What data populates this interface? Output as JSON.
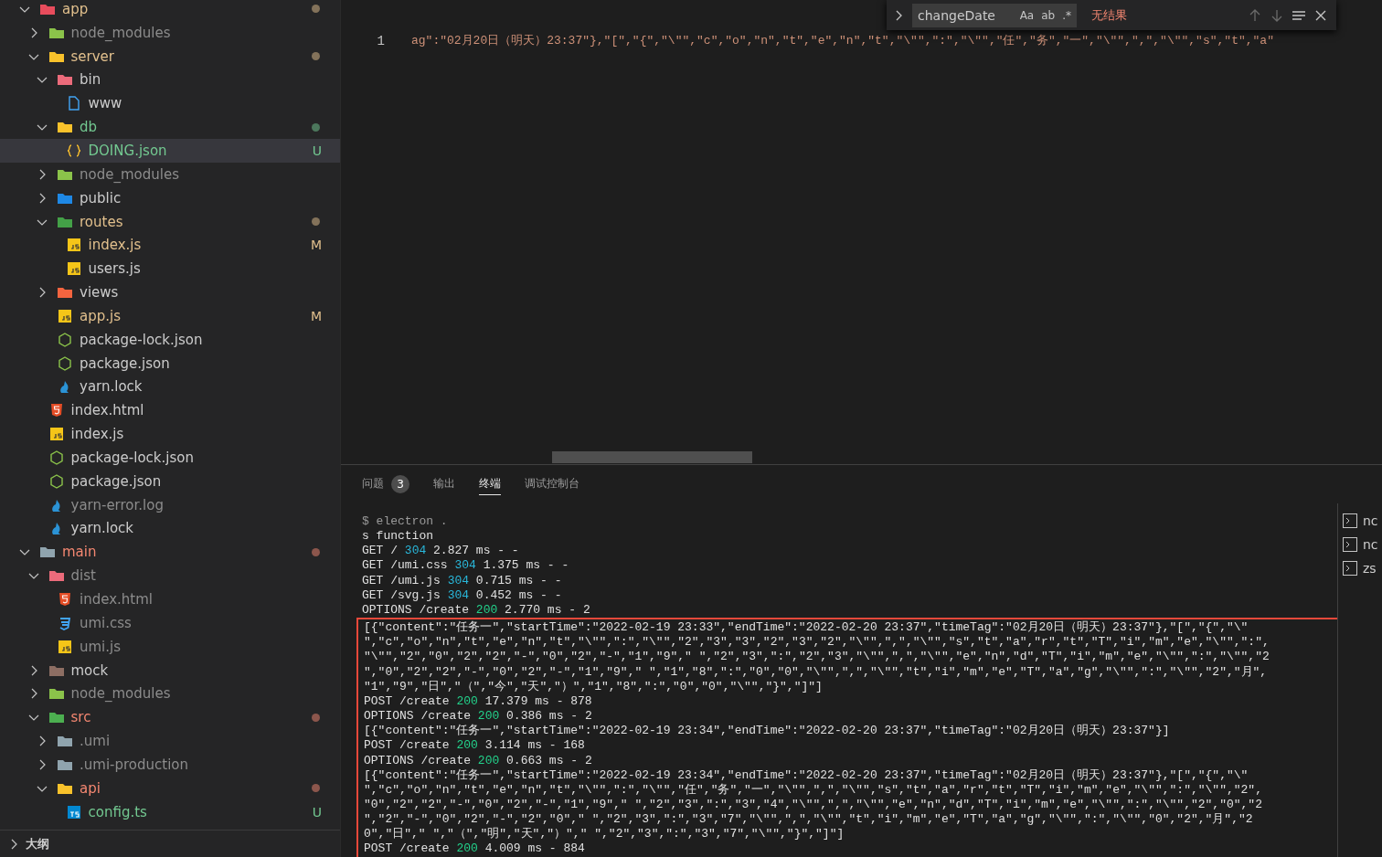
{
  "explorer": {
    "items": [
      {
        "name": "app",
        "kind": "appfolder",
        "color": "#e2c08d",
        "dot": true,
        "expanded": true,
        "selected": false,
        "children": [
          {
            "name": "node_modules",
            "kind": "nodefolder",
            "color": "#8c8c8c",
            "dot": false,
            "expanded": false,
            "selected": false
          },
          {
            "name": "server",
            "kind": "serverfolder",
            "color": "#e2c08d",
            "dot": true,
            "expanded": true,
            "selected": false,
            "children": [
              {
                "name": "bin",
                "kind": "binfolder",
                "color": "#cccccc",
                "dot": false,
                "expanded": true,
                "selected": false,
                "children": [
                  {
                    "name": "www",
                    "kind": "file",
                    "color": "#cccccc",
                    "dot": false,
                    "selected": false
                  }
                ]
              },
              {
                "name": "db",
                "kind": "dbfolder",
                "color": "#73c991",
                "dot": true,
                "expanded": true,
                "selected": false,
                "children": [
                  {
                    "name": "DOING.json",
                    "kind": "jsonfile",
                    "color": "#73c991",
                    "dot": false,
                    "badge": "U",
                    "selected": true
                  }
                ]
              },
              {
                "name": "node_modules",
                "kind": "nodefolder",
                "color": "#8c8c8c",
                "dot": false,
                "expanded": false,
                "selected": false
              },
              {
                "name": "public",
                "kind": "publicfolder",
                "color": "#cccccc",
                "dot": false,
                "expanded": false,
                "selected": false
              },
              {
                "name": "routes",
                "kind": "routesfolder",
                "color": "#e2c08d",
                "dot": true,
                "expanded": true,
                "selected": false,
                "children": [
                  {
                    "name": "index.js",
                    "kind": "jsfile",
                    "color": "#e2c08d",
                    "dot": false,
                    "badge": "M",
                    "selected": false
                  },
                  {
                    "name": "users.js",
                    "kind": "jsfile",
                    "color": "#cccccc",
                    "dot": false,
                    "selected": false
                  }
                ]
              },
              {
                "name": "views",
                "kind": "viewsfolder",
                "color": "#cccccc",
                "dot": false,
                "expanded": false,
                "selected": false
              },
              {
                "name": "app.js",
                "kind": "jsfile",
                "color": "#e2c08d",
                "dot": false,
                "badge": "M",
                "selected": false
              },
              {
                "name": "package-lock.json",
                "kind": "nodefile",
                "color": "#cccccc",
                "dot": false,
                "selected": false
              },
              {
                "name": "package.json",
                "kind": "nodefile",
                "color": "#cccccc",
                "dot": false,
                "selected": false
              },
              {
                "name": "yarn.lock",
                "kind": "yarnfile",
                "color": "#cccccc",
                "dot": false,
                "selected": false
              }
            ]
          },
          {
            "name": "index.html",
            "kind": "htmlfile",
            "color": "#cccccc",
            "dot": false,
            "selected": false
          },
          {
            "name": "index.js",
            "kind": "jsfile",
            "color": "#cccccc",
            "dot": false,
            "selected": false
          },
          {
            "name": "package-lock.json",
            "kind": "nodefile",
            "color": "#cccccc",
            "dot": false,
            "selected": false
          },
          {
            "name": "package.json",
            "kind": "nodefile",
            "color": "#cccccc",
            "dot": false,
            "selected": false
          },
          {
            "name": "yarn-error.log",
            "kind": "yarnfile",
            "color": "#8c8c8c",
            "dot": false,
            "selected": false
          },
          {
            "name": "yarn.lock",
            "kind": "yarnfile",
            "color": "#cccccc",
            "dot": false,
            "selected": false
          }
        ]
      },
      {
        "name": "main",
        "kind": "plainfolder",
        "color": "#f48771",
        "dot": true,
        "expanded": true,
        "selected": false,
        "children": [
          {
            "name": "dist",
            "kind": "binfolder",
            "color": "#8c8c8c",
            "dot": false,
            "expanded": true,
            "selected": false,
            "children": [
              {
                "name": "index.html",
                "kind": "htmlfile",
                "color": "#8c8c8c",
                "dot": false,
                "selected": false
              },
              {
                "name": "umi.css",
                "kind": "cssfile",
                "color": "#8c8c8c",
                "dot": false,
                "selected": false
              },
              {
                "name": "umi.js",
                "kind": "jsfile",
                "color": "#8c8c8c",
                "dot": false,
                "selected": false
              }
            ]
          },
          {
            "name": "mock",
            "kind": "mockfolder",
            "color": "#cccccc",
            "dot": false,
            "expanded": false,
            "selected": false
          },
          {
            "name": "node_modules",
            "kind": "nodefolder",
            "color": "#8c8c8c",
            "dot": false,
            "expanded": false,
            "selected": false
          },
          {
            "name": "src",
            "kind": "srcfolder",
            "color": "#f48771",
            "dot": true,
            "expanded": true,
            "selected": false,
            "children": [
              {
                "name": ".umi",
                "kind": "plainfolder",
                "color": "#8c8c8c",
                "dot": false,
                "expanded": false,
                "selected": false
              },
              {
                "name": ".umi-production",
                "kind": "plainfolder",
                "color": "#8c8c8c",
                "dot": false,
                "expanded": false,
                "selected": false
              },
              {
                "name": "api",
                "kind": "serverfolder",
                "color": "#f48771",
                "dot": true,
                "expanded": true,
                "selected": false,
                "children": [
                  {
                    "name": "config.ts",
                    "kind": "tsfile",
                    "color": "#73c991",
                    "dot": false,
                    "badge": "U",
                    "selected": false
                  }
                ]
              }
            ]
          }
        ]
      }
    ],
    "outline": {
      "title": "大纲",
      "expanded": false
    }
  },
  "editor": {
    "line_number": "1",
    "code": "ag\":\"02月20日（明天）23:37\"},\"[\",\"{\",\"\\\"\",\"c\",\"o\",\"n\",\"t\",\"e\",\"n\",\"t\",\"\\\"\",\":\",\"\\\"\",\"任\",\"务\",\"一\",\"\\\"\",\",\",\"\\\"\",\"s\",\"t\",\"a\""
  },
  "find_widget": {
    "value": "changeDate",
    "options": [
      "Aa",
      "ab",
      ".*"
    ],
    "result": "无结果"
  },
  "panel": {
    "tabs": [
      {
        "label": "问题",
        "count": "3",
        "selected": false
      },
      {
        "label": "输出",
        "selected": false
      },
      {
        "label": "终端",
        "selected": true
      },
      {
        "label": "调试控制台",
        "selected": false
      }
    ],
    "terminal": {
      "lines": [
        {
          "kind": "command",
          "text": "$ electron ."
        },
        {
          "kind": "output",
          "text": "s function"
        },
        {
          "kind": "request",
          "before": "GET /",
          "status": "304",
          "after": "2.827 ms - -",
          "color": "#29b8db"
        },
        {
          "kind": "request",
          "before": "GET /umi.css",
          "status": "304",
          "after": "1.375 ms - -",
          "color": "#29b8db"
        },
        {
          "kind": "request",
          "before": "GET /umi.js",
          "status": "304",
          "after": "0.715 ms - -",
          "color": "#29b8db"
        },
        {
          "kind": "request",
          "before": "GET /svg.js",
          "status": "304",
          "after": "0.452 ms - -",
          "color": "#29b8db"
        },
        {
          "kind": "request",
          "before": "OPTIONS /create",
          "status": "200",
          "after": "2.770 ms - 2",
          "color": "#23d18b"
        }
      ],
      "highlighted_lines": [
        {
          "kind": "output",
          "text": "[{\"content\":\"任务一\",\"startTime\":\"2022-02-19 23:33\",\"endTime\":\"2022-02-20 23:37\",\"timeTag\":\"02月20日（明天）23:37\"},\"[\",\"{\",\"\\\""
        },
        {
          "kind": "output",
          "text": "\",\"c\",\"o\",\"n\",\"t\",\"e\",\"n\",\"t\",\"\\\"\",\":\",\"\\\"\",\"2\",\"3\",\"3\",\"2\",\"3\",\"2\",\"\\\"\",\",\",\"\\\"\",\"s\",\"t\",\"a\",\"r\",\"t\",\"T\",\"i\",\"m\",\"e\",\"\\\"\",\":\","
        },
        {
          "kind": "output",
          "text": "\"\\\"\",\"2\",\"0\",\"2\",\"2\",\"-\",\"0\",\"2\",\"-\",\"1\",\"9\",\" \",\"2\",\"3\",\":\",\"2\",\"3\",\"\\\"\",\",\",\"\\\"\",\"e\",\"n\",\"d\",\"T\",\"i\",\"m\",\"e\",\"\\\"\",\":\",\"\\\"\",\"2"
        },
        {
          "kind": "output",
          "text": "\",\"0\",\"2\",\"2\",\"-\",\"0\",\"2\",\"-\",\"1\",\"9\",\" \",\"1\",\"8\",\":\",\"0\",\"0\",\"\\\"\",\",\",\"\\\"\",\"t\",\"i\",\"m\",\"e\",\"T\",\"a\",\"g\",\"\\\"\",\":\",\"\\\"\",\"2\",\"月\","
        },
        {
          "kind": "output",
          "text": "\"1\",\"9\",\"日\",\"（\",\"今\",\"天\",\"）\",\"1\",\"8\",\":\",\"0\",\"0\",\"\\\"\",\"}\",\"]\"]"
        },
        {
          "kind": "request",
          "before": "POST /create",
          "status": "200",
          "after": "17.379 ms - 878",
          "color": "#23d18b"
        },
        {
          "kind": "request",
          "before": "OPTIONS /create",
          "status": "200",
          "after": "0.386 ms - 2",
          "color": "#23d18b"
        },
        {
          "kind": "output",
          "text": "[{\"content\":\"任务一\",\"startTime\":\"2022-02-19 23:34\",\"endTime\":\"2022-02-20 23:37\",\"timeTag\":\"02月20日（明天）23:37\"}]"
        },
        {
          "kind": "request",
          "before": "POST /create",
          "status": "200",
          "after": "3.114 ms - 168",
          "color": "#23d18b"
        },
        {
          "kind": "request",
          "before": "OPTIONS /create",
          "status": "200",
          "after": "0.663 ms - 2",
          "color": "#23d18b"
        },
        {
          "kind": "output",
          "text": "[{\"content\":\"任务一\",\"startTime\":\"2022-02-19 23:34\",\"endTime\":\"2022-02-20 23:37\",\"timeTag\":\"02月20日（明天）23:37\"},\"[\",\"{\",\"\\\""
        },
        {
          "kind": "output",
          "text": "\",\"c\",\"o\",\"n\",\"t\",\"e\",\"n\",\"t\",\"\\\"\",\":\",\"\\\"\",\"任\",\"务\",\"一\",\"\\\"\",\",\",\"\\\"\",\"s\",\"t\",\"a\",\"r\",\"t\",\"T\",\"i\",\"m\",\"e\",\"\\\"\",\":\",\"\\\"\",\"2\","
        },
        {
          "kind": "output",
          "text": "\"0\",\"2\",\"2\",\"-\",\"0\",\"2\",\"-\",\"1\",\"9\",\" \",\"2\",\"3\",\":\",\"3\",\"4\",\"\\\"\",\",\",\"\\\"\",\"e\",\"n\",\"d\",\"T\",\"i\",\"m\",\"e\",\"\\\"\",\":\",\"\\\"\",\"2\",\"0\",\"2"
        },
        {
          "kind": "output",
          "text": "\",\"2\",\"-\",\"0\",\"2\",\"-\",\"2\",\"0\",\" \",\"2\",\"3\",\":\",\"3\",\"7\",\"\\\"\",\",\",\"\\\"\",\"t\",\"i\",\"m\",\"e\",\"T\",\"a\",\"g\",\"\\\"\",\":\",\"\\\"\",\"0\",\"2\",\"月\",\"2"
        },
        {
          "kind": "output",
          "text": "0\",\"日\",\" \",\"（\",\"明\",\"天\",\"）\",\" \",\"2\",\"3\",\":\",\"3\",\"7\",\"\\\"\",\"}\",\"]\"]"
        },
        {
          "kind": "request",
          "before": "POST /create",
          "status": "200",
          "after": "4.009 ms - 884",
          "color": "#23d18b"
        }
      ]
    },
    "terminal_list": [
      "nc",
      "nc",
      "zs"
    ]
  }
}
